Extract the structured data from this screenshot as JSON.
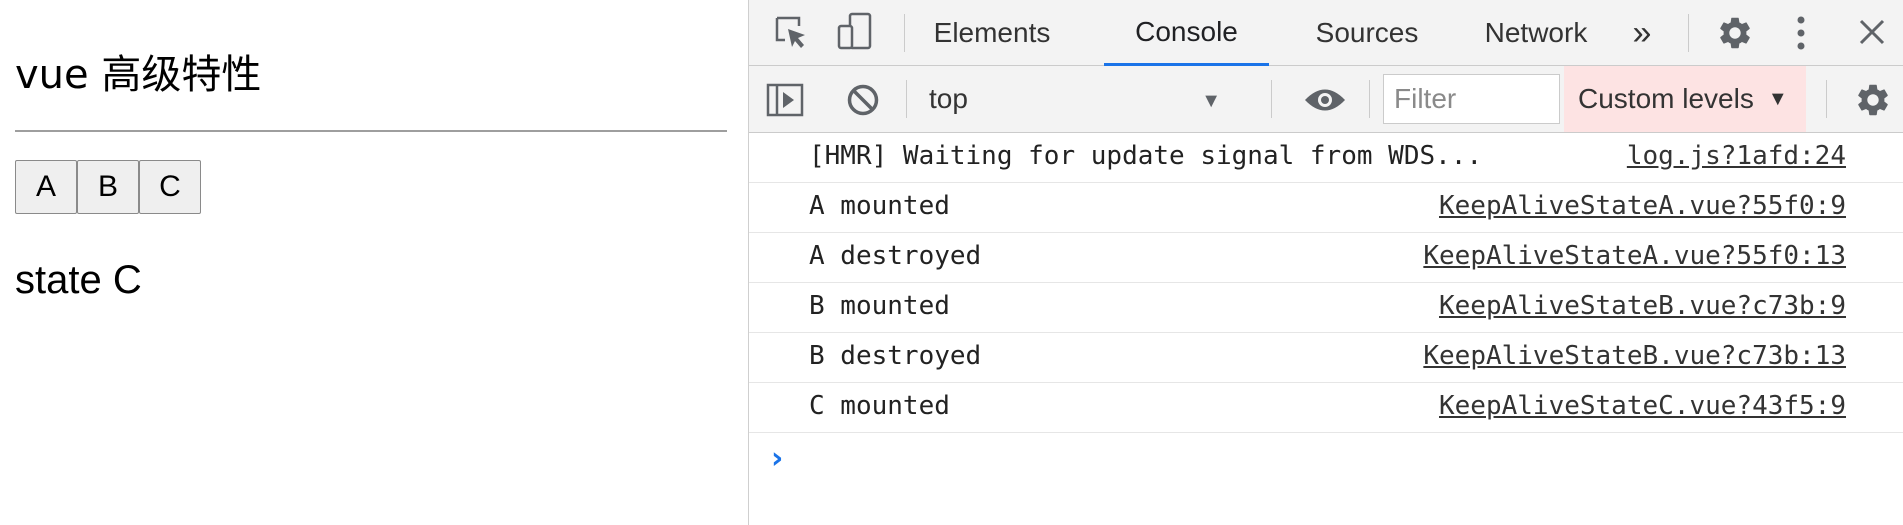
{
  "page": {
    "title": "vue 高级特性",
    "buttons": [
      "A",
      "B",
      "C"
    ],
    "state_text": "state C"
  },
  "devtools": {
    "tabs": [
      {
        "label": "Elements",
        "active": false
      },
      {
        "label": "Console",
        "active": true
      },
      {
        "label": "Sources",
        "active": false
      },
      {
        "label": "Network",
        "active": false
      }
    ],
    "more_tabs_glyph": "»",
    "context": "top",
    "filter_placeholder": "Filter",
    "levels_label": "Custom levels",
    "accent_color": "#1a73e8",
    "messages": [
      {
        "text": "[HMR] Waiting for update signal from WDS...",
        "source": "log.js?1afd:24"
      },
      {
        "text": "A mounted",
        "source": "KeepAliveStateA.vue?55f0:9"
      },
      {
        "text": "A destroyed",
        "source": "KeepAliveStateA.vue?55f0:13"
      },
      {
        "text": "B mounted",
        "source": "KeepAliveStateB.vue?c73b:9"
      },
      {
        "text": "B destroyed",
        "source": "KeepAliveStateB.vue?c73b:13"
      },
      {
        "text": "C mounted",
        "source": "KeepAliveStateC.vue?43f5:9"
      }
    ]
  }
}
